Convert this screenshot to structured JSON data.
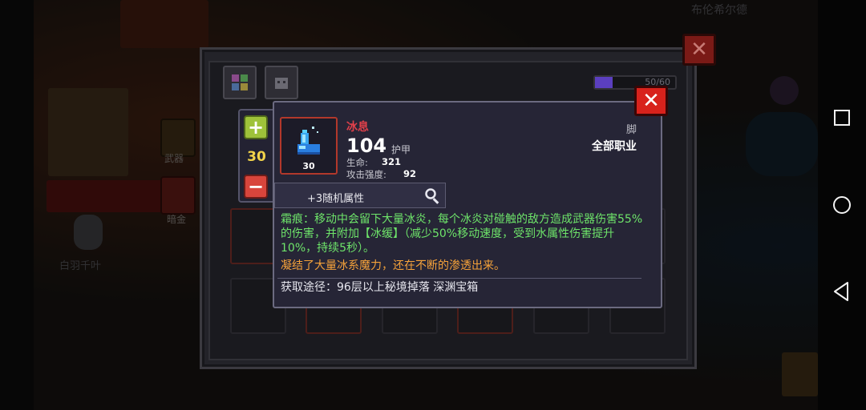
{
  "background": {
    "map_name": "布伦希尔德",
    "character_name": "白羽千叶",
    "side_buttons": [
      {
        "label": "武器"
      },
      {
        "label": "暗金"
      }
    ]
  },
  "inventory": {
    "capacity_text": "50/60",
    "capacity_fraction": 0.22
  },
  "level_stepper": {
    "value": "30"
  },
  "tooltip": {
    "item_name": "冰息",
    "item_level": "30",
    "main_value": "104",
    "main_unit": "护甲",
    "stats": [
      {
        "label": "生命:",
        "value": "321"
      },
      {
        "label": "攻击强度:",
        "value": "92"
      }
    ],
    "slot_type": "脚",
    "class_requirement": "全部职业",
    "random_attributes": "+3随机属性",
    "effect_text": "霜痕：移动中会留下大量冰炎，每个冰炎对碰触的敌方造成武器伤害55%的伤害，并附加【冰缓】（减少50%移动速度，受到水属性伤害提升10%，持续5秒）。",
    "flavor_text": "凝结了大量冰系魔力，还在不断的渗透出来。",
    "source_text": "获取途径：96层以上秘境掉落 深渊宝箱"
  },
  "colors": {
    "item_name": "#e0404a",
    "effect": "#6ee46a",
    "flavor": "#f5a23a",
    "stepper_value": "#f1d24a"
  },
  "icons": {
    "close": "close-icon",
    "magnify": "magnifier-icon",
    "plus": "plus-icon",
    "minus": "minus-icon",
    "item": "ice-boot-icon"
  },
  "system_nav": [
    "recent-apps",
    "home",
    "back"
  ]
}
